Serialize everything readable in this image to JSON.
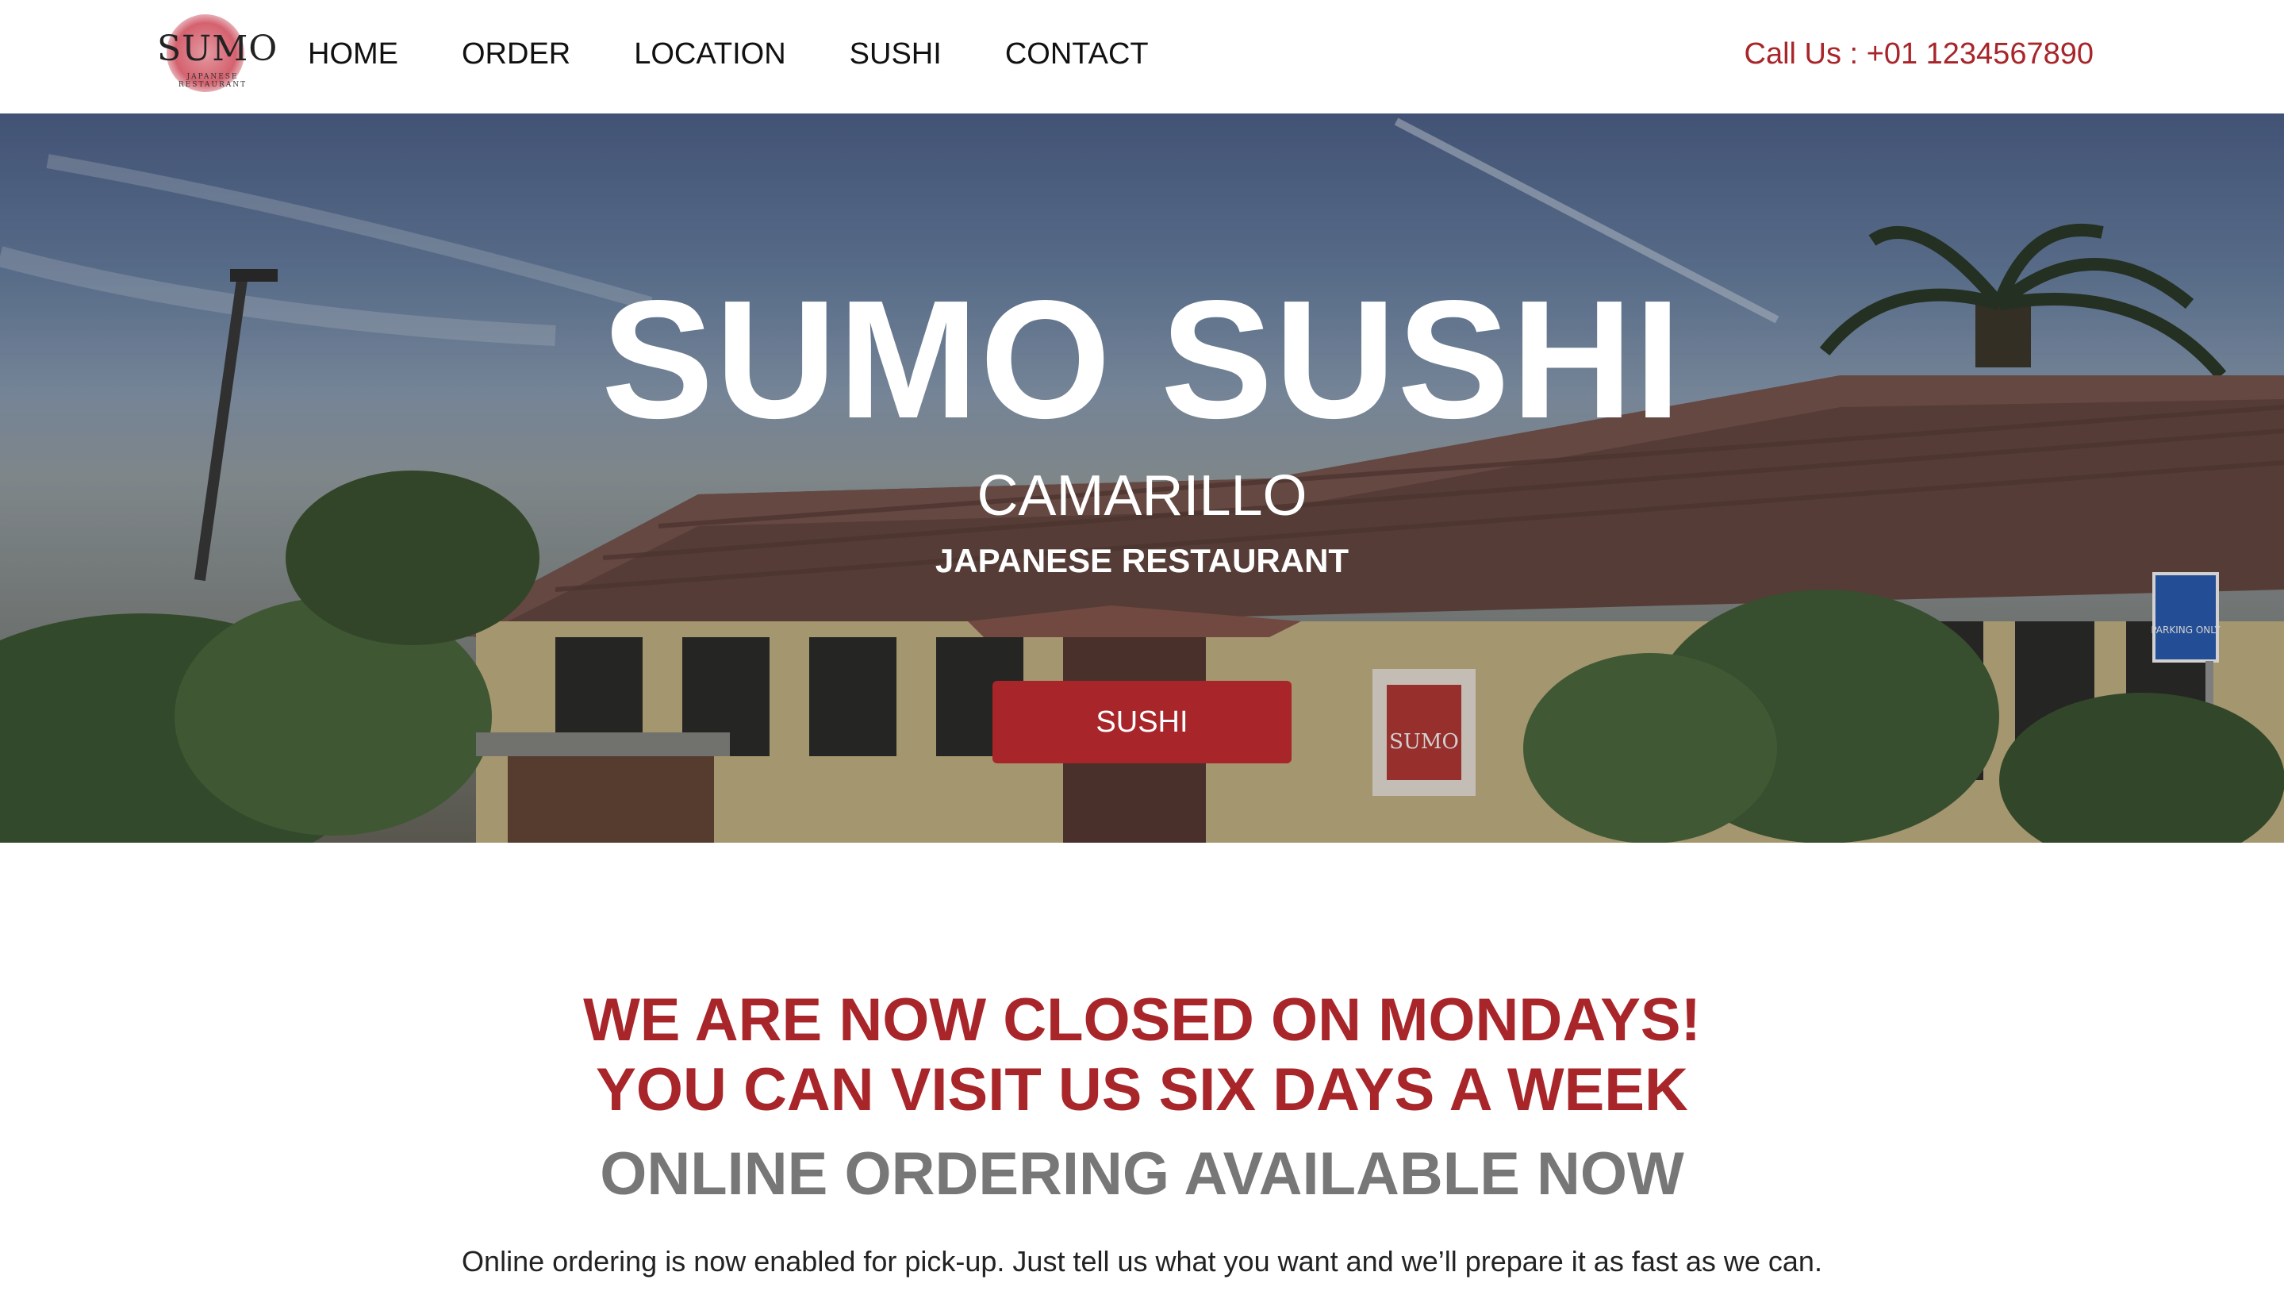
{
  "header": {
    "logo": {
      "word": "SUMO",
      "subtitle": "JAPANESE RESTAURANT"
    },
    "nav": [
      "HOME",
      "ORDER",
      "LOCATION",
      "SUSHI",
      "CONTACT"
    ],
    "call": "Call Us : +01 1234567890"
  },
  "hero": {
    "title": "SUMO SUSHI",
    "city": "CAMARILLO",
    "subtitle": "JAPANESE RESTAURANT",
    "button": "SUSHI",
    "signs": {
      "parking": "PARKING ONLY",
      "sumo_banner": "SUMO"
    }
  },
  "notice": {
    "line1": "WE ARE NOW CLOSED ON MONDAYS!",
    "line2": "YOU CAN VISIT US SIX DAYS A WEEK",
    "online": "ONLINE ORDERING AVAILABLE NOW",
    "para1": "Online ordering is now enabled for pick-up. Just tell us what you want and we’ll prepare it as fast as we can."
  },
  "colors": {
    "accent": "#a8252a",
    "muted_heading": "#777777"
  }
}
